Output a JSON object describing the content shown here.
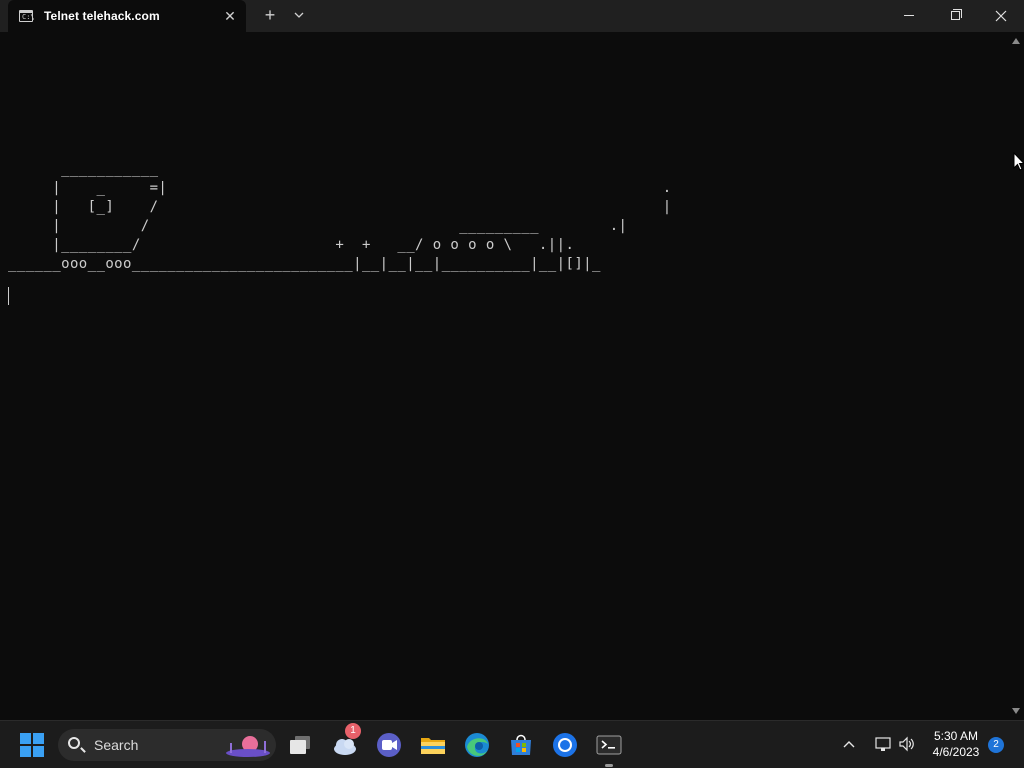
{
  "window": {
    "tab_title": "Telnet telehack.com",
    "tab_icon": "terminal-icon",
    "new_tab_symbol": "+",
    "dropdown_symbol": "⌄",
    "close_symbol": "✕"
  },
  "terminal": {
    "ascii_art": "      ___________\n     |    _     =|                                                        .\n     |   [_]    /                                                         |\n     |         /                                   _________        .|\n     |________/                      +  +   __/ o o o o \\   .||.\n______ooo__ooo_________________________|__|__|__|__________|__|[]|_"
  },
  "taskbar": {
    "search_label": "Search",
    "weather_badge": "1",
    "clock_time": "5:30 AM",
    "clock_date": "4/6/2023",
    "notification_count": "2",
    "pinned": [
      "start-icon",
      "task-view-icon",
      "weather-icon",
      "teams-icon",
      "file-explorer-icon",
      "edge-icon",
      "store-icon",
      "chrome-icon",
      "terminal-icon"
    ]
  },
  "colors": {
    "terminal_bg": "#0c0c0c",
    "terminal_fg": "#cccccc",
    "titlebar_bg": "#202020",
    "taskbar_bg": "#1c1c1c",
    "accent": "#3aa0f3"
  }
}
